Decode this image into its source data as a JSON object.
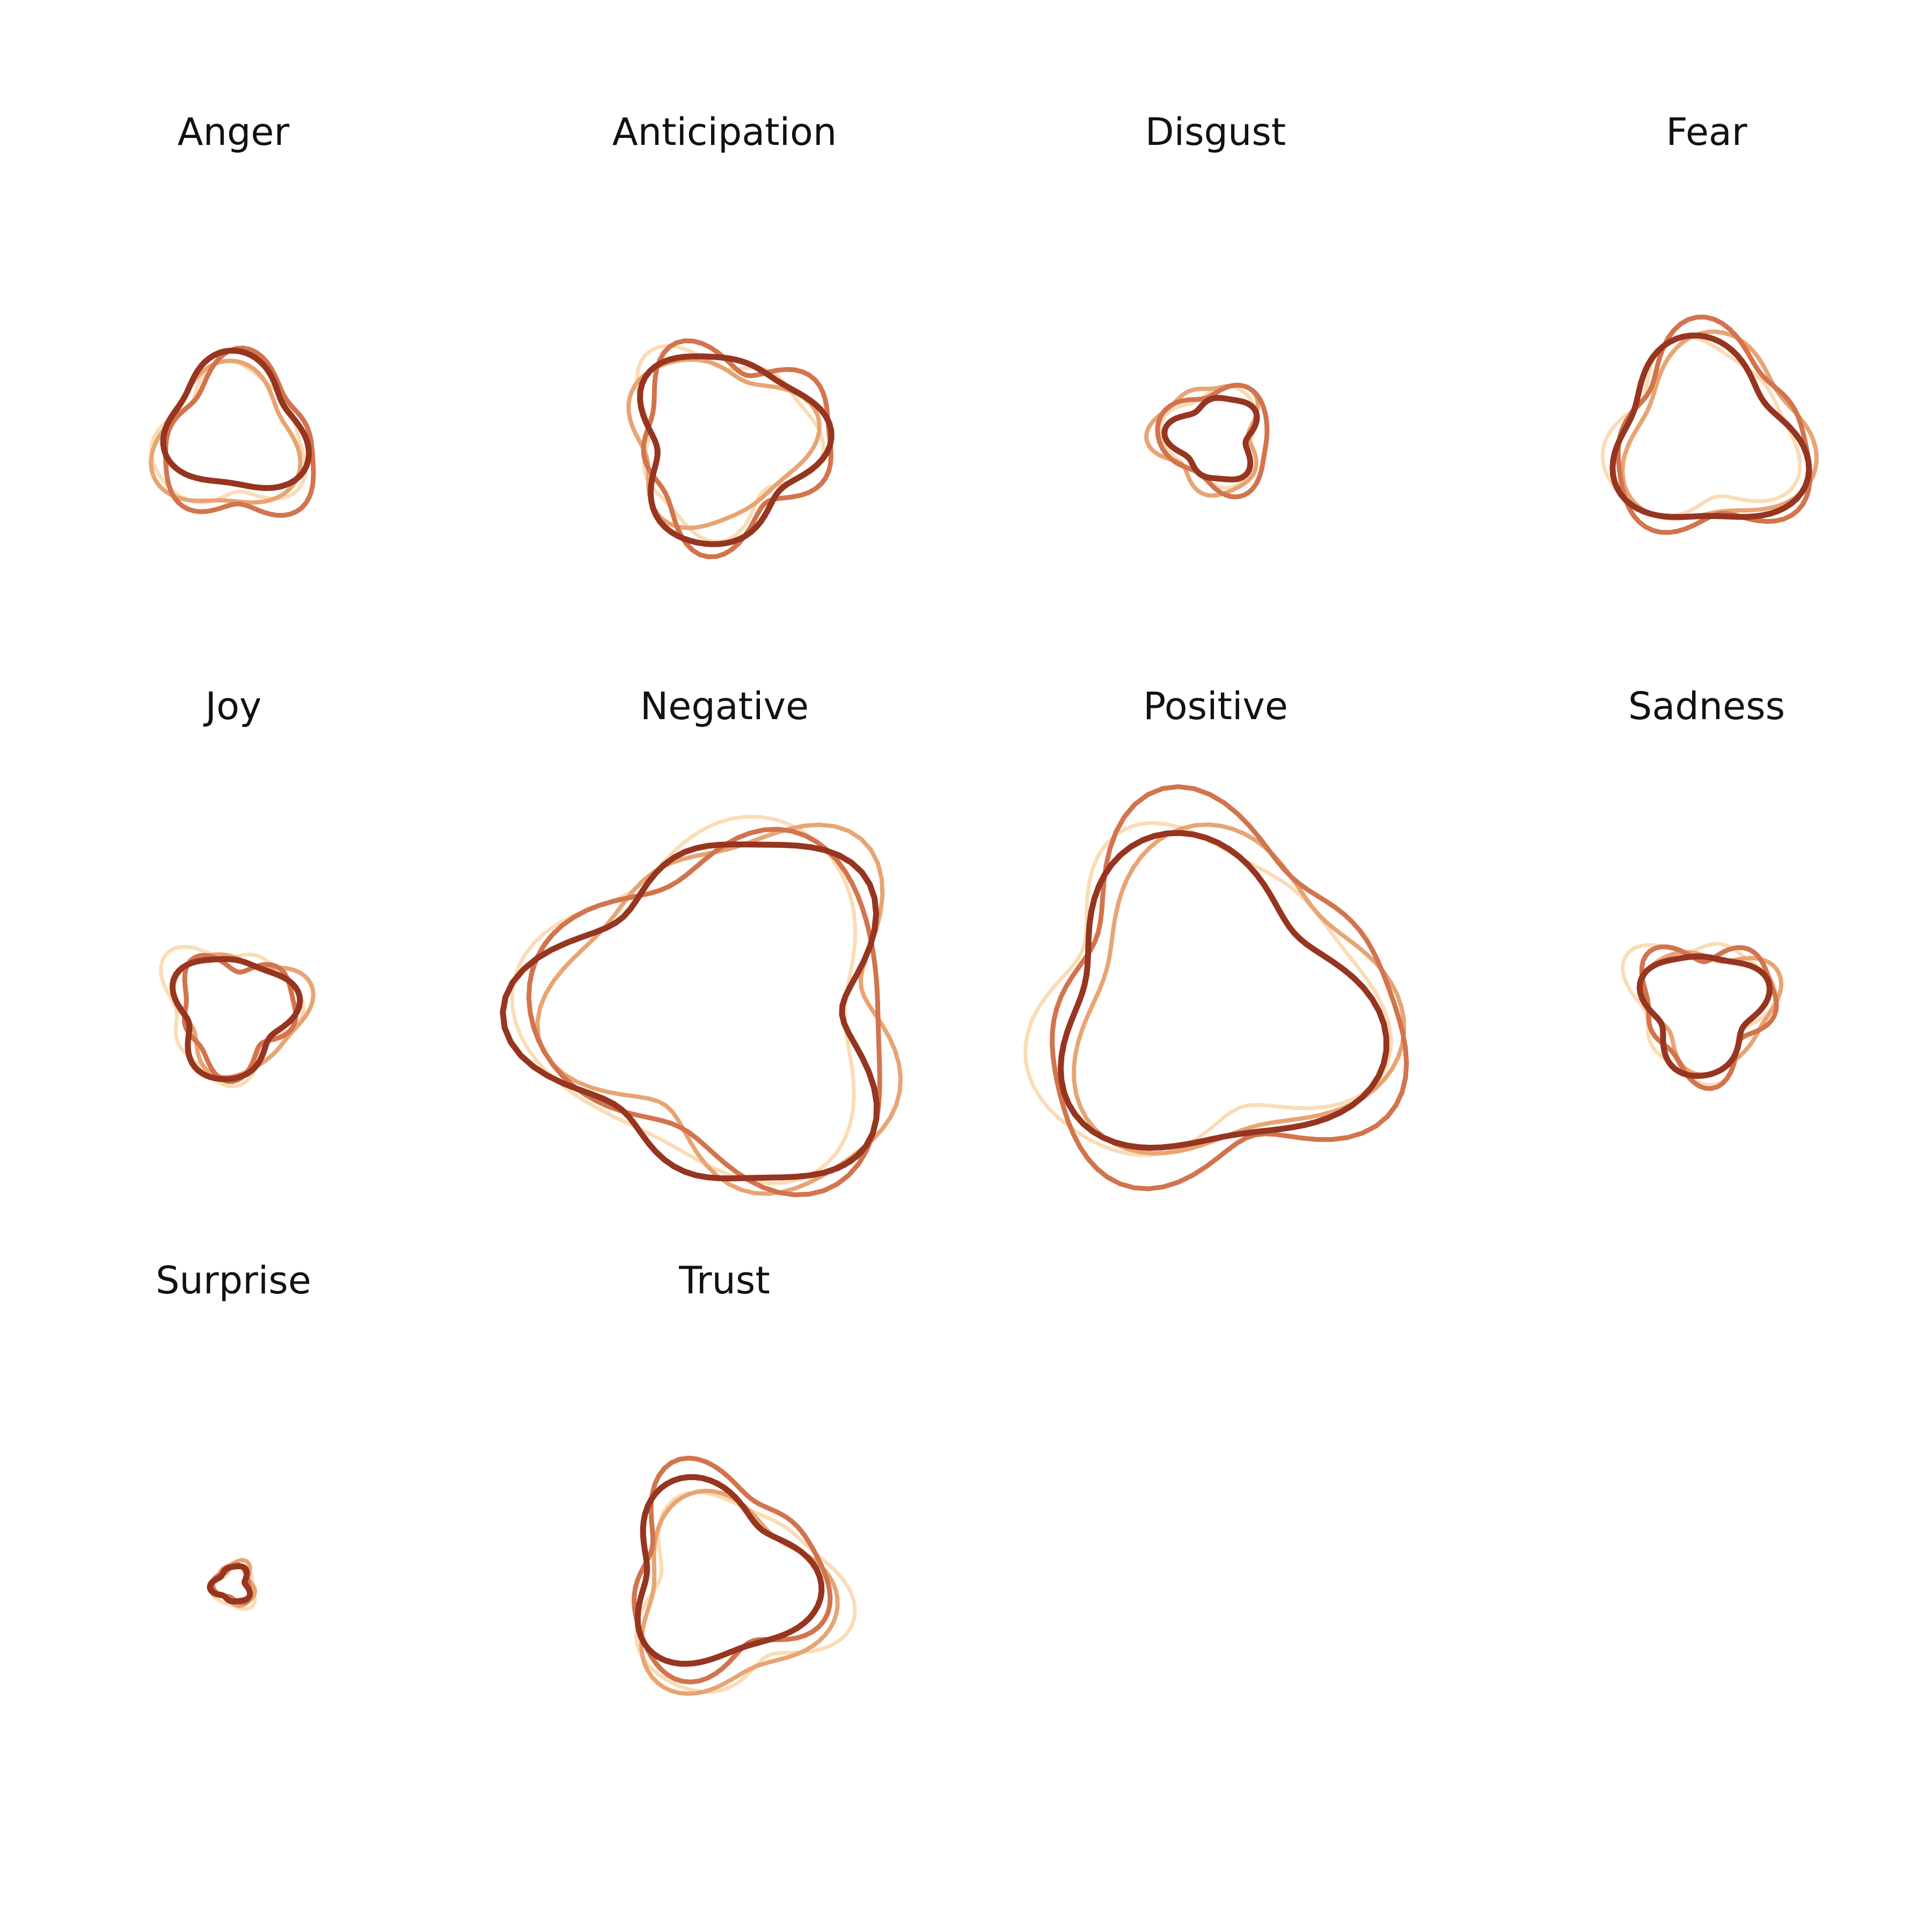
{
  "chart_data": {
    "type": "radar",
    "layout": "small-multiples grid, 4 columns x 3 rows",
    "shape_style": "hand-drawn (sketchy) closed loops",
    "series_colors": [
      "#fbdcb6",
      "#e8a472",
      "#d2744d",
      "#963520"
    ],
    "panels": [
      {
        "title": "Anger",
        "series_radii": [
          0.24,
          0.24,
          0.26,
          0.23
        ]
      },
      {
        "title": "Anticipation",
        "series_radii": [
          0.3,
          0.29,
          0.32,
          0.31
        ]
      },
      {
        "title": "Disgust",
        "series_radii": [
          0.16,
          0.18,
          0.18,
          0.14
        ]
      },
      {
        "title": "Fear",
        "series_radii": [
          0.3,
          0.31,
          0.33,
          0.31
        ]
      },
      {
        "title": "Joy",
        "series_radii": [
          0.22,
          0.21,
          0.19,
          0.2
        ]
      },
      {
        "title": "Negative",
        "series_radii": [
          0.58,
          0.58,
          0.58,
          0.58
        ]
      },
      {
        "title": "Positive",
        "series_radii": [
          0.55,
          0.53,
          0.6,
          0.52
        ]
      },
      {
        "title": "Sadness",
        "series_radii": [
          0.23,
          0.21,
          0.22,
          0.2
        ]
      },
      {
        "title": "Surprise",
        "series_radii": [
          0.07,
          0.07,
          0.06,
          0.06
        ]
      },
      {
        "title": "Trust",
        "series_radii": [
          0.33,
          0.32,
          0.33,
          0.3
        ]
      }
    ]
  }
}
